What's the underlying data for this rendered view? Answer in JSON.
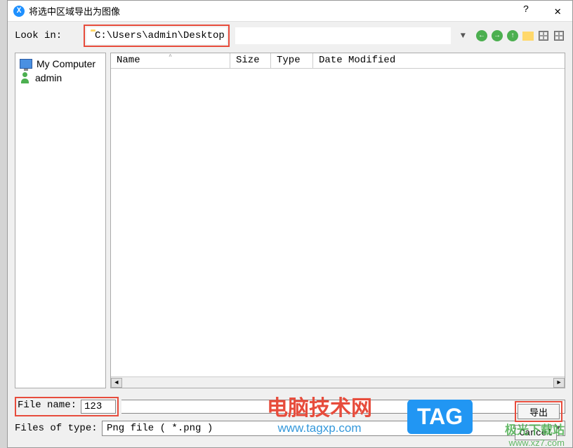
{
  "titlebar": {
    "icon_letter": "X",
    "title": "将选中区域导出为图像",
    "help": "?",
    "close": "✕"
  },
  "toolbar": {
    "look_in_label": "Look in:",
    "path": "C:\\Users\\admin\\Desktop"
  },
  "sidebar": {
    "items": [
      {
        "label": "My Computer",
        "icon": "monitor"
      },
      {
        "label": "admin",
        "icon": "user"
      }
    ]
  },
  "file_list": {
    "columns": {
      "name": "Name",
      "size": "Size",
      "type": "Type",
      "date": "Date Modified"
    },
    "sort_indicator": "^"
  },
  "form": {
    "filename_label": "File name:",
    "filename_value": "123",
    "filetype_label": "Files of type:",
    "filetype_value": "Png file ( *.png )"
  },
  "buttons": {
    "export": "导出",
    "cancel": "Cancel"
  },
  "watermarks": {
    "wm1_title": "电脑技术网",
    "wm1_url": "www.tagxp.com",
    "tag": "TAG",
    "wm2_title": "极光下载站",
    "wm2_url": "www.xz7.com"
  }
}
